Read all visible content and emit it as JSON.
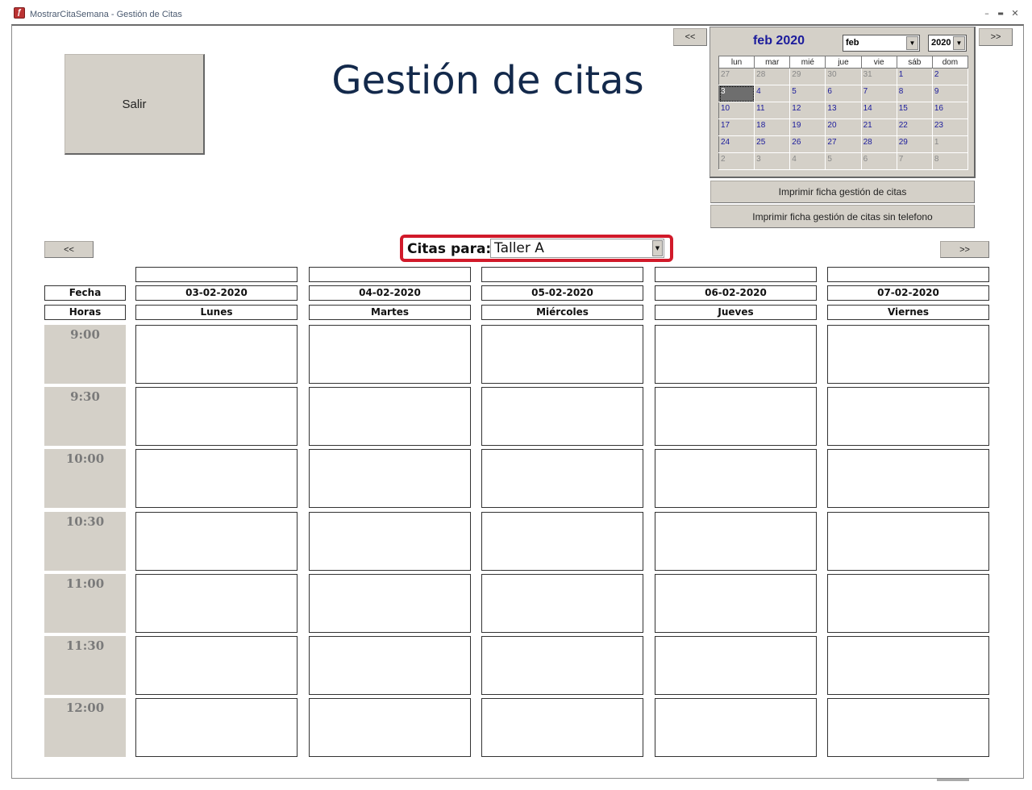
{
  "window": {
    "title": "MostrarCitaSemana - Gestión de Citas",
    "controls": {
      "minimize": "–",
      "maximize": "▬",
      "close": "✕"
    }
  },
  "header": {
    "exit_label": "Salir",
    "page_title": "Gestión de citas"
  },
  "calendar": {
    "prev_label": "<<",
    "next_label": ">>",
    "month_title": "feb 2020",
    "month_select": "feb",
    "year_select": "2020",
    "weekdays": [
      "lun",
      "mar",
      "mié",
      "jue",
      "vie",
      "sáb",
      "dom"
    ],
    "weeks": [
      [
        "27",
        "28",
        "29",
        "30",
        "31",
        "1",
        "2"
      ],
      [
        "3",
        "4",
        "5",
        "6",
        "7",
        "8",
        "9"
      ],
      [
        "10",
        "11",
        "12",
        "13",
        "14",
        "15",
        "16"
      ],
      [
        "17",
        "18",
        "19",
        "20",
        "21",
        "22",
        "23"
      ],
      [
        "24",
        "25",
        "26",
        "27",
        "28",
        "29",
        "1"
      ],
      [
        "2",
        "3",
        "4",
        "5",
        "6",
        "7",
        "8"
      ]
    ],
    "other_month_cells": [
      "0-0",
      "0-1",
      "0-2",
      "0-3",
      "0-4",
      "4-6",
      "5-0",
      "5-1",
      "5-2",
      "5-3",
      "5-4",
      "5-5",
      "5-6"
    ],
    "selected_cell": "1-0"
  },
  "print": {
    "button1": "Imprimir ficha gestión de citas",
    "button2": "Imprimir ficha gestión de citas sin telefono"
  },
  "week_nav": {
    "prev_label": "<<",
    "next_label": ">>"
  },
  "citas": {
    "label": "Citas para:",
    "selected": "Taller A"
  },
  "schedule": {
    "fecha_label": "Fecha",
    "horas_label": "Horas",
    "days": [
      {
        "date": "03-02-2020",
        "name": "Lunes"
      },
      {
        "date": "04-02-2020",
        "name": "Martes"
      },
      {
        "date": "05-02-2020",
        "name": "Miércoles"
      },
      {
        "date": "06-02-2020",
        "name": "Jueves"
      },
      {
        "date": "07-02-2020",
        "name": "Viernes"
      }
    ],
    "times": [
      "9:00",
      "9:30",
      "10:00",
      "10:30",
      "11:00",
      "11:30",
      "12:00"
    ]
  }
}
